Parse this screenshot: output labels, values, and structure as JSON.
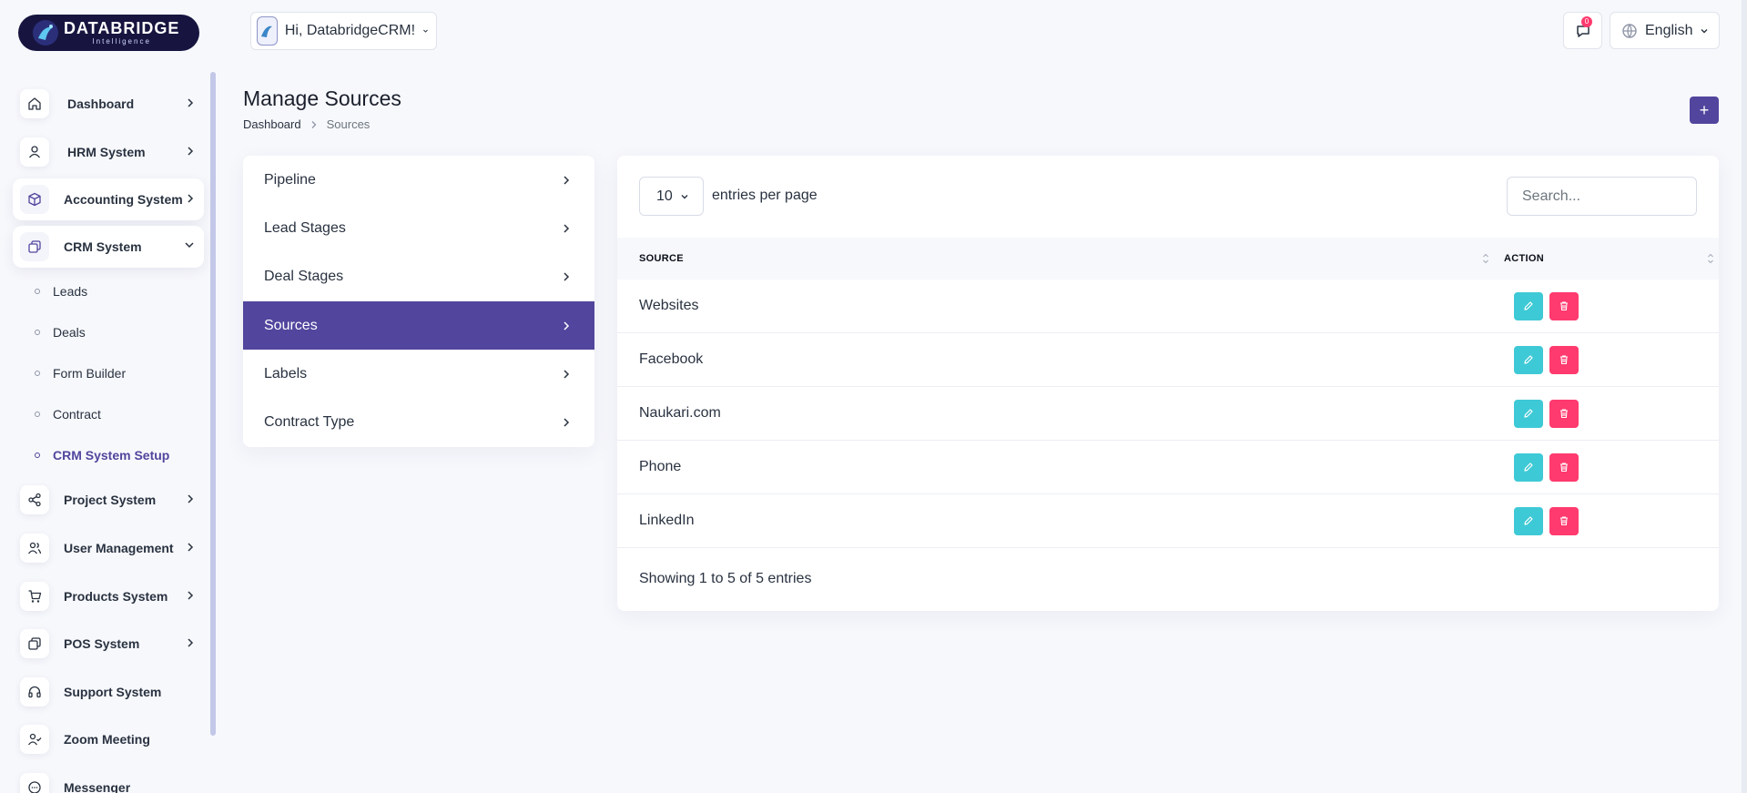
{
  "brand": {
    "name": "DATABRIDGE",
    "tagline": "Intelligence"
  },
  "header": {
    "greeting": "Hi, DatabridgeCRM!",
    "notification_count": "0",
    "language": "English"
  },
  "sidebar": {
    "items": [
      {
        "label": "Dashboard",
        "icon": "home-icon"
      },
      {
        "label": "HRM System",
        "icon": "user-icon"
      },
      {
        "label": "Accounting System",
        "icon": "box-icon"
      },
      {
        "label": "CRM System",
        "icon": "layers-icon"
      },
      {
        "label": "Project System",
        "icon": "share-icon"
      },
      {
        "label": "User Management",
        "icon": "users-icon"
      },
      {
        "label": "Products System",
        "icon": "cart-icon"
      },
      {
        "label": "POS System",
        "icon": "layers-icon"
      },
      {
        "label": "Support System",
        "icon": "headphones-icon"
      },
      {
        "label": "Zoom Meeting",
        "icon": "user-check-icon"
      },
      {
        "label": "Messenger",
        "icon": "message-icon"
      }
    ],
    "crm_sub": [
      "Leads",
      "Deals",
      "Form Builder",
      "Contract",
      "CRM System Setup"
    ]
  },
  "page": {
    "title": "Manage Sources",
    "breadcrumb": [
      "Dashboard",
      "Sources"
    ],
    "add_label": "+"
  },
  "setup_menu": [
    "Pipeline",
    "Lead Stages",
    "Deal Stages",
    "Sources",
    "Labels",
    "Contract Type"
  ],
  "table": {
    "per_page": "10",
    "per_page_label": "entries per page",
    "search_placeholder": "Search...",
    "columns": [
      "SOURCE",
      "ACTION"
    ],
    "rows": [
      "Websites",
      "Facebook",
      "Naukari.com",
      "Phone",
      "LinkedIn"
    ],
    "footer": "Showing 1 to 5 of 5 entries"
  },
  "colors": {
    "primary": "#51459d",
    "edit": "#3ec9d6",
    "delete": "#ff3a6e"
  }
}
